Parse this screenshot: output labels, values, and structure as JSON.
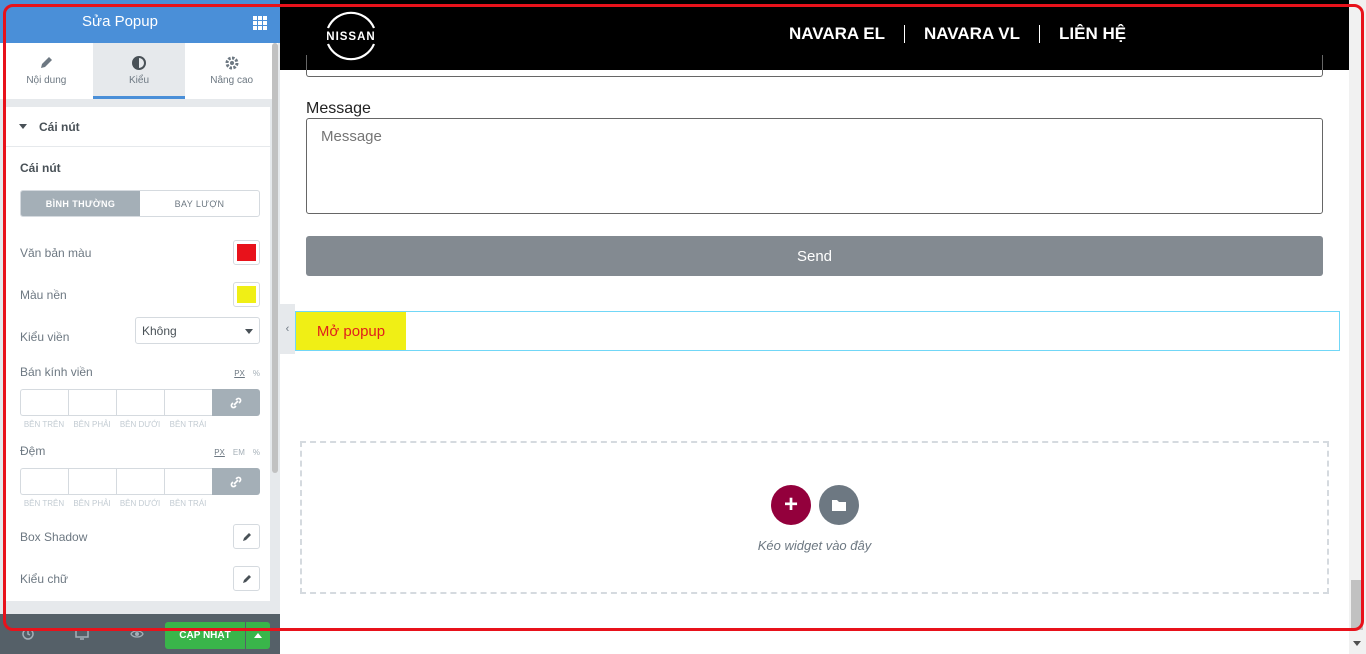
{
  "editor": {
    "title": "Sửa Popup",
    "menu_icon": "grid-icon",
    "tabs": [
      {
        "label": "Nội dung",
        "icon": "pencil-icon"
      },
      {
        "label": "Kiểu",
        "icon": "contrast-icon",
        "active": true
      },
      {
        "label": "Nâng cao",
        "icon": "gear-icon"
      }
    ],
    "section_title": "Cái nút",
    "control_heading": "Cái nút",
    "state_toggle": [
      "BÌNH THƯỜNG",
      "BAY LƯỢN"
    ],
    "text_color_label": "Văn bản màu",
    "text_color": "#e8121b",
    "bg_color_label": "Màu nền",
    "bg_color": "#f0ef15",
    "border_type_label": "Kiểu viền",
    "border_type_value": "Không",
    "border_radius_label": "Bán kính viền",
    "border_radius_units": [
      "PX",
      "%"
    ],
    "padding_label": "Đệm",
    "padding_units": [
      "PX",
      "EM",
      "%"
    ],
    "dimension_labels": [
      "BÊN TRÊN",
      "BÊN PHẢI",
      "BÊN DƯỚI",
      "BÊN TRÁI"
    ],
    "box_shadow_label": "Box Shadow",
    "typography_label": "Kiểu chữ",
    "update_label": "CẬP NHẬT"
  },
  "site": {
    "logo_text": "NISSAN",
    "menu": [
      "NAVARA EL",
      "NAVARA VL",
      "LIÊN HỆ"
    ]
  },
  "form": {
    "message_label": "Message",
    "message_placeholder": "Message",
    "send_label": "Send"
  },
  "popup_button": "Mở popup",
  "dropzone_text": "Kéo widget vào đây",
  "colors": {
    "editor_blue": "#4a8fd8",
    "update_green": "#39b54a",
    "add_button": "#93003c",
    "highlight": "#e8121b"
  }
}
